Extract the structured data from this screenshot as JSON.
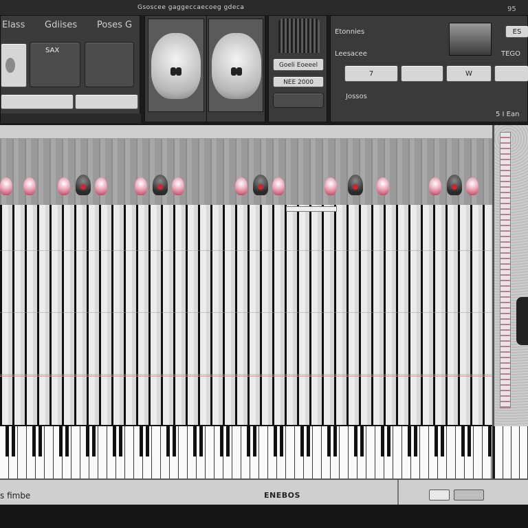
{
  "window": {
    "title": "Gsoscee gaggeccaecoeg gdeca",
    "corner_number": "95"
  },
  "header": {
    "tabs": [
      {
        "label": "Elass"
      },
      {
        "label": "Gdiises"
      },
      {
        "label": "Poses G"
      }
    ],
    "sax_button": "SAX",
    "center_panel": {
      "label_1": "Goeli Eoeeel",
      "label_2": "NEE 2000"
    },
    "right_panel": {
      "label_top": "Etonnies",
      "label_mid": "Leesacee",
      "tag_top": "ES",
      "tag_mid": "TEGO",
      "field_label": "Jossos",
      "buttons": [
        {
          "label": "7"
        },
        {
          "label": ""
        },
        {
          "label": "W"
        },
        {
          "label": ""
        }
      ],
      "corner_label": "5 I Ean"
    }
  },
  "colors": {
    "accent": "#d3233a",
    "petal": "#e89bb0",
    "background": "#1b1b1b",
    "panel": "#3a3a3a"
  },
  "status_bar": {
    "left_text": "s fimbe",
    "center_text": "ENEBOS"
  }
}
